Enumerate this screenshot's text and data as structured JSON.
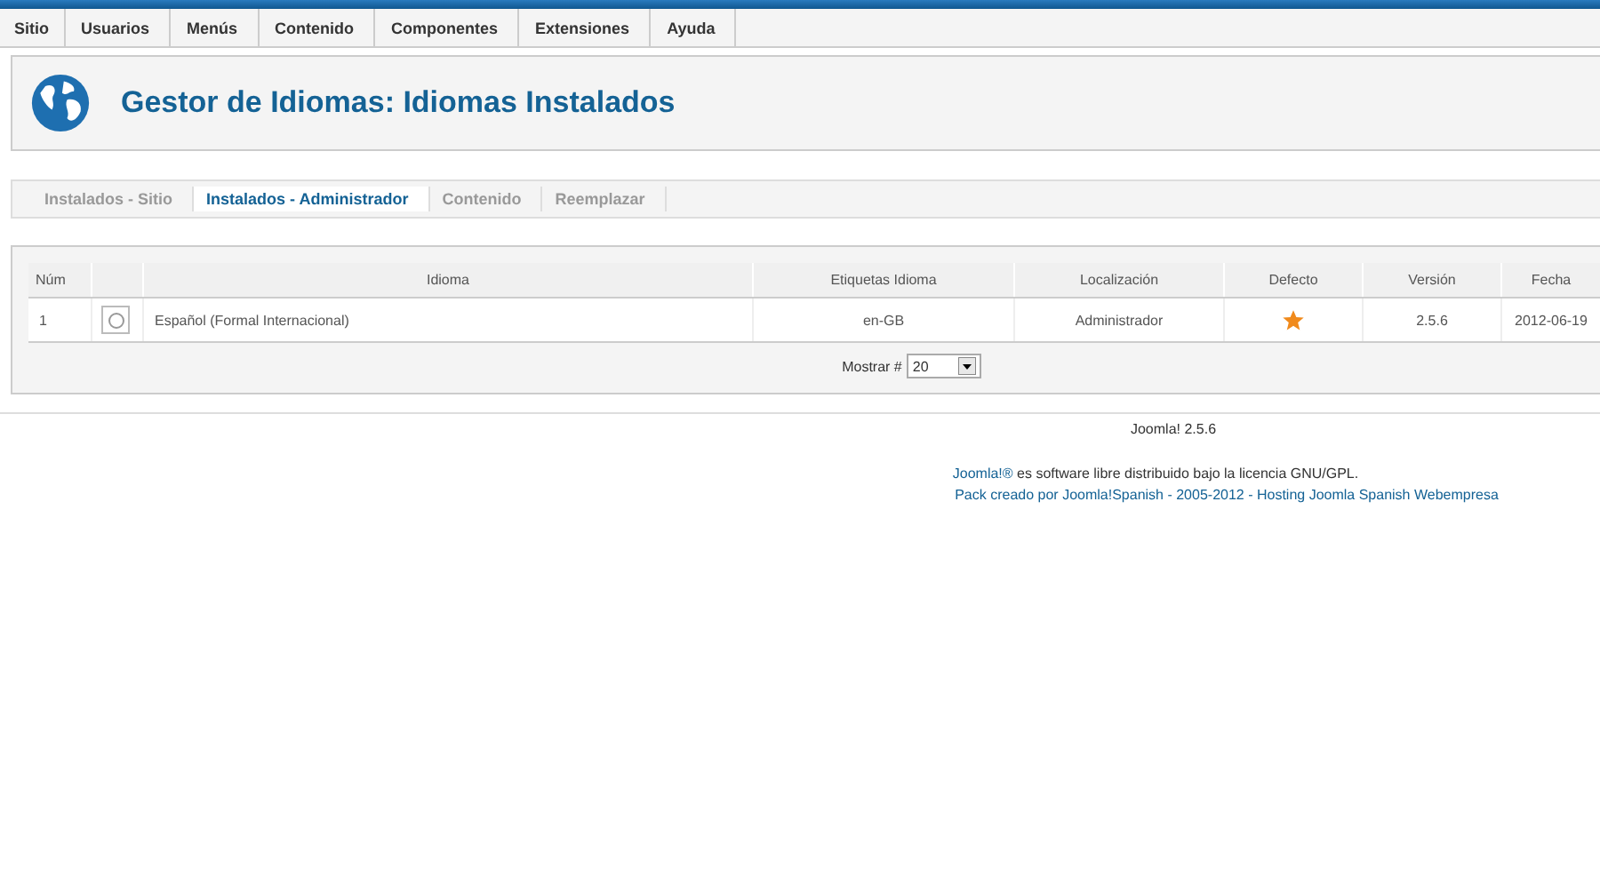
{
  "menu": [
    {
      "label": "Sitio"
    },
    {
      "label": "Usuarios"
    },
    {
      "label": "Menús"
    },
    {
      "label": "Contenido"
    },
    {
      "label": "Componentes"
    },
    {
      "label": "Extensiones"
    },
    {
      "label": "Ayuda"
    }
  ],
  "header": {
    "title": "Gestor de Idiomas: Idiomas Instalados"
  },
  "subtabs": [
    {
      "label": "Instalados - Sitio",
      "selected": false
    },
    {
      "label": "Instalados - Administrador",
      "selected": true
    },
    {
      "label": "Contenido",
      "selected": false
    },
    {
      "label": "Reemplazar",
      "selected": false
    }
  ],
  "table": {
    "columns": [
      "Núm",
      "Idioma",
      "Etiquetas Idioma",
      "Localización",
      "Defecto",
      "Versión",
      "Fecha"
    ],
    "rows": [
      {
        "num": "1",
        "selected": false,
        "language": "Español (Formal Internacional)",
        "tag": "en-GB",
        "location": "Administrador",
        "default": true,
        "version": "2.5.6",
        "date": "2012-06-19"
      }
    ]
  },
  "pagination": {
    "label": "Mostrar #",
    "value": "20"
  },
  "footer": {
    "version": "Joomla! 2.5.6",
    "license_link": "Joomla!®",
    "license_text": "es software libre distribuido bajo la licencia GNU/GPL.",
    "credits_link": "Pack creado por Joomla!Spanish - 2005-2012 - Hosting Joomla Spanish Webempresa"
  }
}
